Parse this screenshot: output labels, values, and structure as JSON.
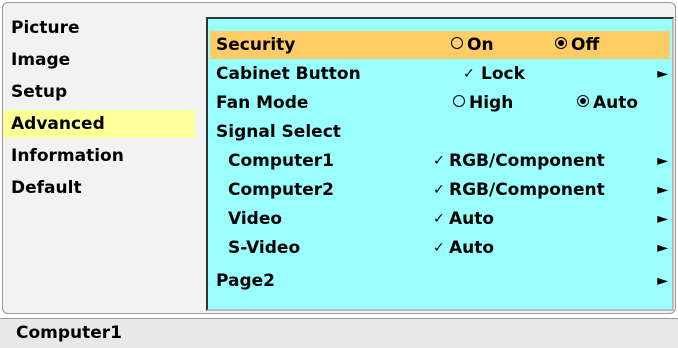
{
  "left_menu": {
    "items": [
      "Picture",
      "Image",
      "Setup",
      "Advanced",
      "Information",
      "Default"
    ],
    "selected": "Advanced"
  },
  "panel": {
    "security": {
      "label": "Security",
      "option_on": "On",
      "option_off": "Off",
      "selected": "Off"
    },
    "cabinet_button": {
      "label": "Cabinet Button",
      "value": "Lock"
    },
    "fan_mode": {
      "label": "Fan Mode",
      "option_high": "High",
      "option_auto": "Auto",
      "selected": "Auto"
    },
    "signal_select": {
      "label": "Signal Select"
    },
    "computer1": {
      "label": "Computer1",
      "value": "RGB/Component"
    },
    "computer2": {
      "label": "Computer2",
      "value": "RGB/Component"
    },
    "video": {
      "label": "Video",
      "value": "Auto"
    },
    "svideo": {
      "label": "S-Video",
      "value": "Auto"
    },
    "page2": {
      "label": "Page2"
    }
  },
  "status_bar": {
    "text": "Computer1"
  },
  "icons": {
    "checkmark": "✓",
    "submenu_arrow": "►"
  },
  "colors": {
    "panel_bg": "#99ffff",
    "highlight_row": "#ffcc66",
    "selected_left_item": "#ffff99"
  }
}
